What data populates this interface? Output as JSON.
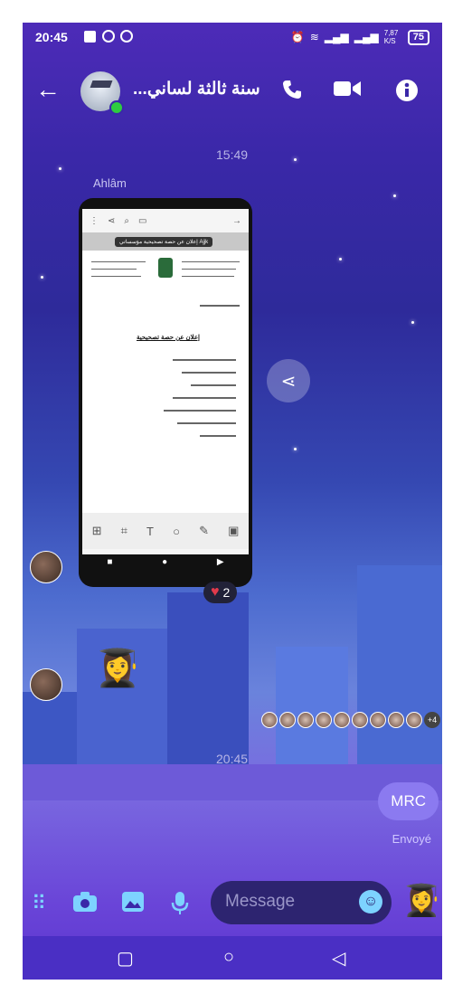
{
  "status": {
    "time": "20:45",
    "battery": "75",
    "net": "7,87 K/S"
  },
  "header": {
    "title": "سنة ثالثة لساني...",
    "back_icon": "arrow-left-icon",
    "call_icon": "phone-icon",
    "video_icon": "video-icon",
    "info_icon": "info-icon"
  },
  "chat": {
    "timestamp_top": "15:49",
    "sender": "Ahlâm",
    "reaction_count": "2",
    "seen_more": "+4",
    "timestamp_bottom": "20:45",
    "message": "MRC",
    "message_status": "Envoyé"
  },
  "doc": {
    "label": "إعلان عن حصة تصحيحية مؤسساتي Ajjk",
    "heading": "إعلان عن حصة تصحيحية"
  },
  "composer": {
    "placeholder": "Message"
  },
  "colors": {
    "accent": "#7dd3ff",
    "bubble": "#8b7af0",
    "heart": "#e23a4b"
  }
}
